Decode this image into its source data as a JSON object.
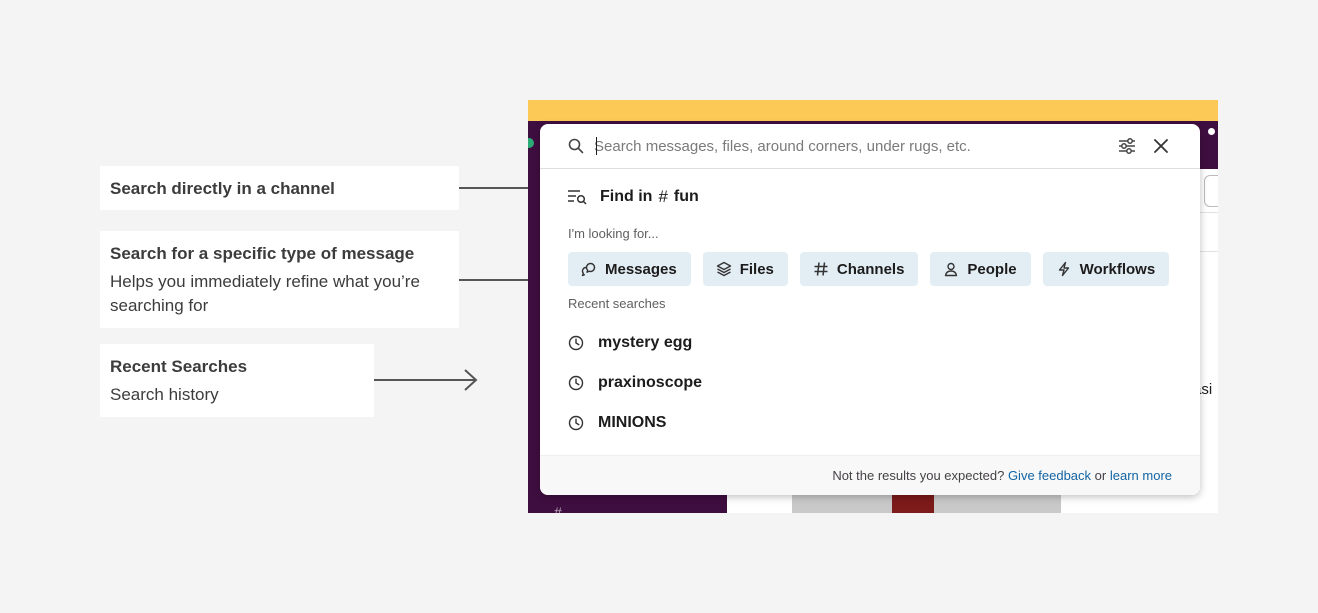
{
  "callouts": [
    {
      "title": "Search directly in a channel",
      "subtitle": ""
    },
    {
      "title": "Search for a specific type of message",
      "subtitle": "Helps you immediately refine what you’re searching for"
    },
    {
      "title": "Recent Searches",
      "subtitle": "Search history"
    }
  ],
  "background_app": {
    "partial_text": "asi",
    "partial_channel": "# ..."
  },
  "search": {
    "placeholder": "Search messages, files, around corners, under rugs, etc.",
    "value": ""
  },
  "find_in": {
    "label": "Find in",
    "channel": "fun"
  },
  "looking_for": {
    "label": "I'm looking for...",
    "chips": [
      {
        "label": "Messages",
        "icon": "messages-icon"
      },
      {
        "label": "Files",
        "icon": "files-icon"
      },
      {
        "label": "Channels",
        "icon": "hash-icon"
      },
      {
        "label": "People",
        "icon": "people-icon"
      },
      {
        "label": "Workflows",
        "icon": "workflows-icon"
      }
    ]
  },
  "recent": {
    "label": "Recent searches",
    "items": [
      "mystery egg",
      "praxinoscope",
      "MINIONS"
    ]
  },
  "footer": {
    "prefix": "Not the results you expected?",
    "feedback_link": "Give feedback",
    "or": "or",
    "learn_link": "learn more"
  },
  "colors": {
    "sidebar": "#3f0e40",
    "banner": "#fcc957",
    "chip_bg": "#e3eef4",
    "link": "#1264a3"
  }
}
